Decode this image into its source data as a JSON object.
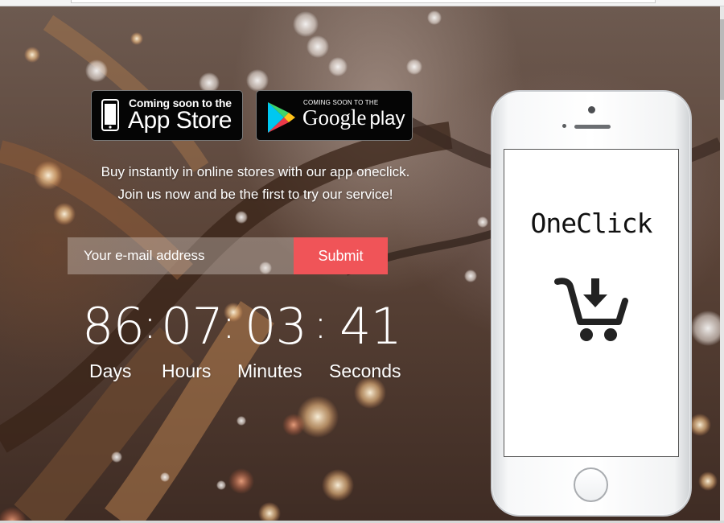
{
  "badges": {
    "app_store": {
      "line1": "Coming soon to the",
      "line2": "App Store"
    },
    "google_play": {
      "line1": "COMING SOON TO THE",
      "line2": "Google",
      "line3": "play"
    }
  },
  "tagline": {
    "line1": "Buy instantly in online stores with our app oneclick.",
    "line2": "Join us now and be the first to try our service!"
  },
  "form": {
    "email_placeholder": "Your e-mail address",
    "submit_label": "Submit"
  },
  "countdown": {
    "days": "86",
    "hours": "07",
    "minutes": "03",
    "seconds": "41",
    "separator": ":",
    "labels": {
      "days": "Days",
      "hours": "Hours",
      "minutes": "Minutes",
      "seconds": "Seconds"
    }
  },
  "phone": {
    "app_name": "OneClick",
    "icon": "cart-download-icon"
  },
  "colors": {
    "accent": "#f05458",
    "badge_bg": "#050505",
    "text": "#ffffff"
  }
}
